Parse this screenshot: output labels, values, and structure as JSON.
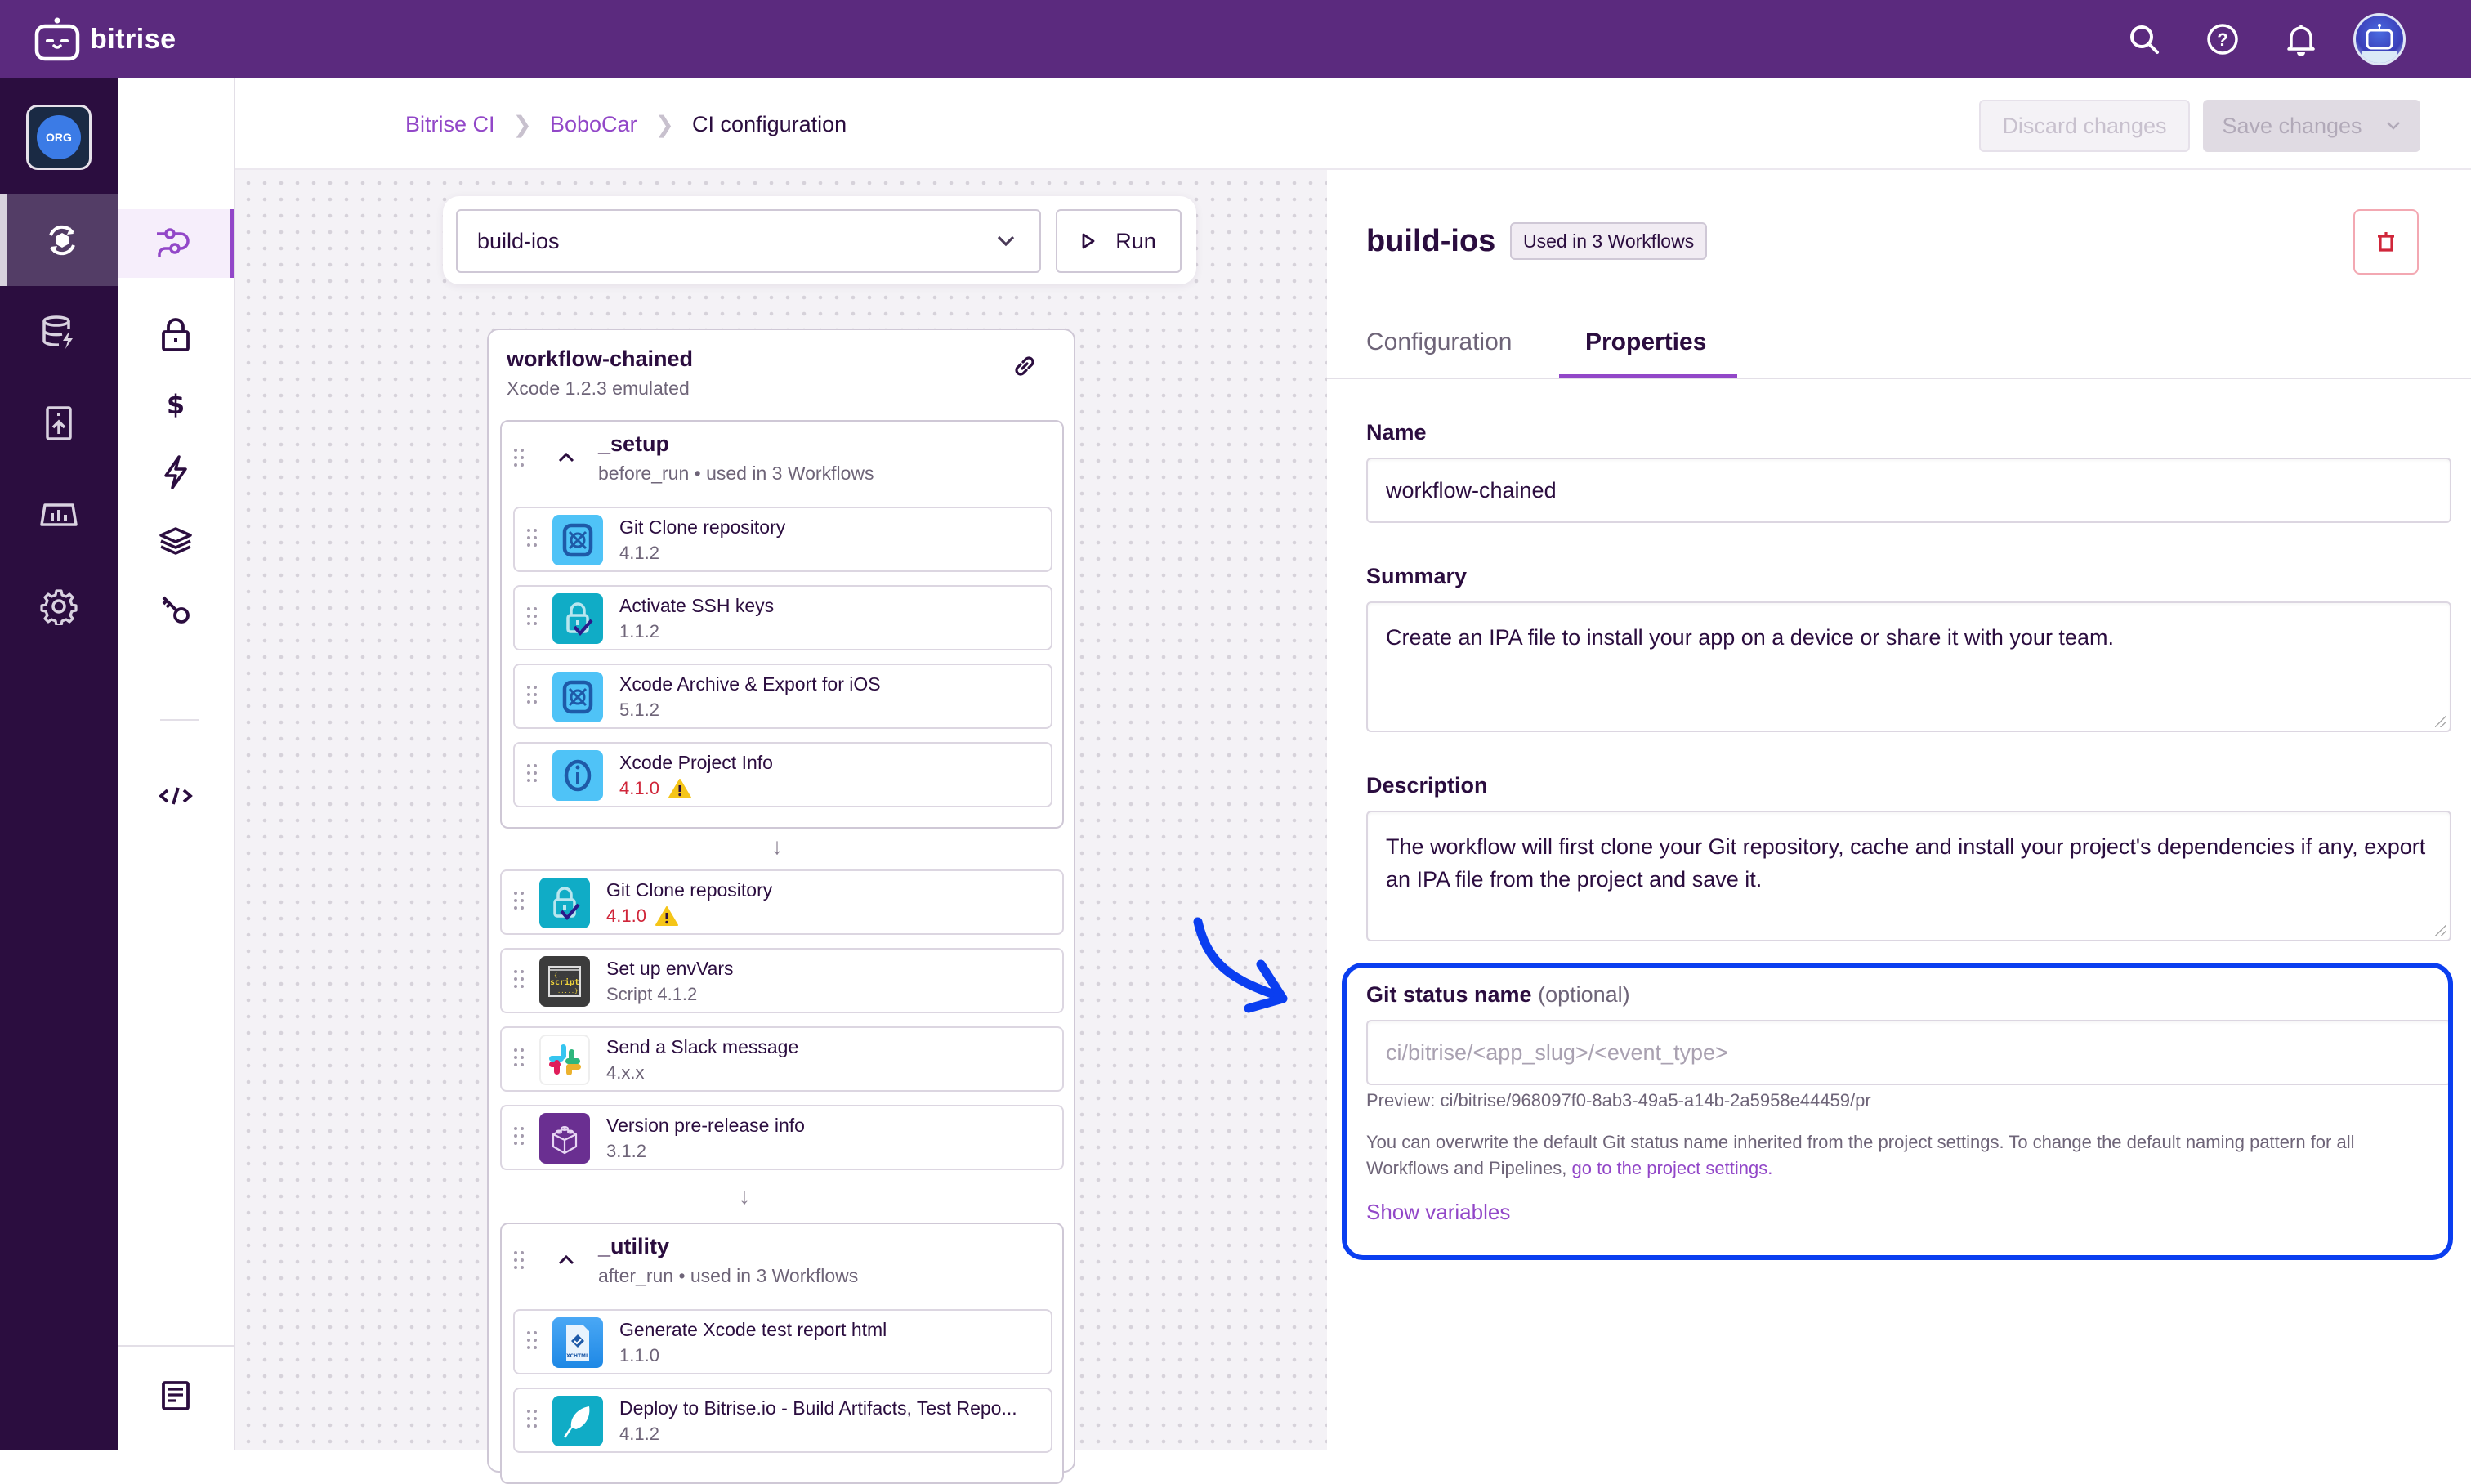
{
  "topbar": {
    "brand": "bitrise",
    "icons": [
      "search-icon",
      "help-icon",
      "bell-icon",
      "avatar"
    ]
  },
  "rail": {
    "org_badge": "ORG",
    "items": [
      {
        "icon": "ci-icon",
        "active": true
      },
      {
        "icon": "cache-icon",
        "active": false
      },
      {
        "icon": "release-icon",
        "active": false
      },
      {
        "icon": "insights-icon",
        "active": false
      },
      {
        "icon": "settings-icon",
        "active": false
      }
    ]
  },
  "subnav": {
    "items": [
      {
        "icon": "workflows-icon",
        "active": true
      },
      {
        "icon": "secrets-icon",
        "active": false
      },
      {
        "icon": "env-vars-icon",
        "active": false
      },
      {
        "icon": "triggers-icon",
        "active": false
      },
      {
        "icon": "stacks-icon",
        "active": false
      },
      {
        "icon": "code-signing-icon",
        "active": false
      },
      {
        "icon": "yaml-icon",
        "active": false
      },
      {
        "icon": "docs-icon",
        "active": false
      }
    ]
  },
  "breadcrumb": {
    "items": [
      "Bitrise CI",
      "BoboCar"
    ],
    "current": "CI configuration"
  },
  "actions": {
    "discard": "Discard changes",
    "save": "Save changes"
  },
  "canvas": {
    "selected_workflow": "build-ios",
    "run_label": "Run",
    "workflow": {
      "title": "workflow-chained",
      "subtitle": "Xcode 1.2.3 emulated"
    },
    "setup_group": {
      "title": "_setup",
      "subtitle": "before_run • used in 3 Workflows",
      "steps": [
        {
          "name": "Git Clone repository",
          "version": "4.1.2",
          "warning": false,
          "icon": "xcode-icon"
        },
        {
          "name": "Activate SSH keys",
          "version": "1.1.2",
          "warning": false,
          "icon": "ssh-lock-icon"
        },
        {
          "name": "Xcode Archive & Export for iOS",
          "version": "5.1.2",
          "warning": false,
          "icon": "xcode-icon"
        },
        {
          "name": "Xcode Project Info",
          "version": "4.1.0",
          "warning": true,
          "icon": "xcode-info-icon"
        }
      ]
    },
    "main_steps": [
      {
        "name": "Git Clone repository",
        "version": "4.1.0",
        "warning": true,
        "icon": "ssh-lock-icon"
      },
      {
        "name": "Set up envVars",
        "version": "Script 4.1.2",
        "warning": false,
        "icon": "script-icon"
      },
      {
        "name": "Send a Slack message",
        "version": "4.x.x",
        "warning": false,
        "icon": "slack-icon"
      },
      {
        "name": "Version pre-release info",
        "version": "3.1.2",
        "warning": false,
        "icon": "package-icon"
      }
    ],
    "utility_group": {
      "title": "_utility",
      "subtitle": "after_run • used in 3 Workflows",
      "steps": [
        {
          "name": "Generate Xcode test report html",
          "version": "1.1.0",
          "warning": false,
          "icon": "xchtml-icon"
        },
        {
          "name": "Deploy to Bitrise.io - Build Artifacts, Test Repo...",
          "version": "4.1.2",
          "warning": false,
          "icon": "deploy-icon"
        }
      ]
    }
  },
  "panel": {
    "title": "build-ios",
    "badge": "Used in 3 Workflows",
    "tabs": [
      {
        "label": "Configuration",
        "active": false
      },
      {
        "label": "Properties",
        "active": true
      }
    ],
    "name_label": "Name",
    "name_value": "workflow-chained",
    "summary_label": "Summary",
    "summary_value": "Create an IPA file to install your app on a device or share it with your team.",
    "description_label": "Description",
    "description_value": "The workflow will first clone your Git repository, cache and install your project's dependencies if any, export an IPA file from the project and save it.",
    "git_status_label": "Git status name",
    "git_status_optional": "(optional)",
    "git_status_placeholder": "ci/bitrise/<app_slug>/<event_type>",
    "git_status_preview": "Preview: ci/bitrise/968097f0-8ab3-49a5-a14b-2a5958e44459/pr",
    "git_status_help": "You can overwrite the default Git status name inherited from the project settings. To change the default naming pattern for all Workflows and Pipelines, ",
    "git_status_help_link": "go to the project settings.",
    "show_variables": "Show variables"
  },
  "colors": {
    "brand": "#5b2a7e",
    "rail": "#2b0d3f",
    "accent": "#9247c8",
    "warning_text": "#d0263a",
    "warning_icon": "#f5c518",
    "annotation": "#0a3ef0"
  }
}
